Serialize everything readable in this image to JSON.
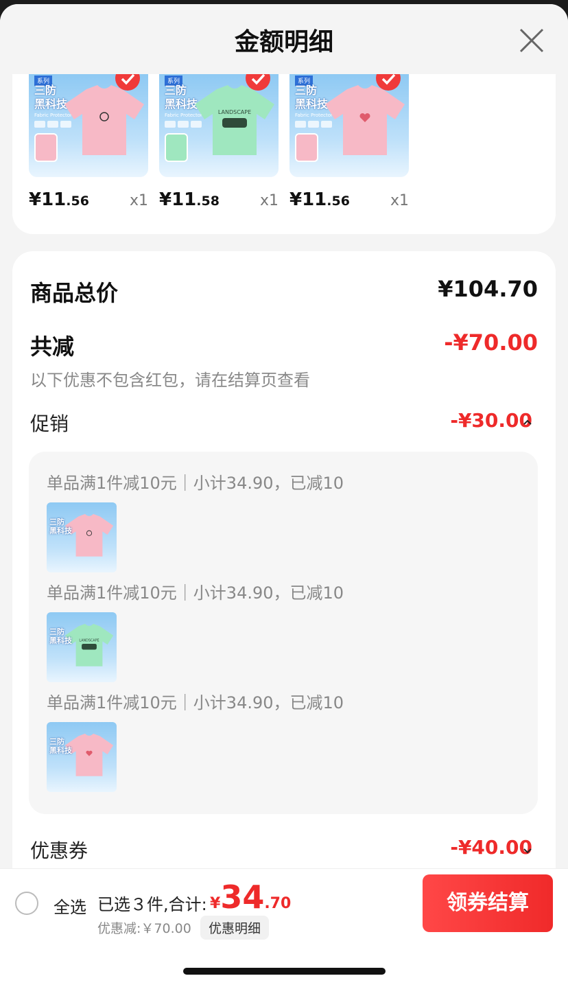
{
  "header": {
    "title": "金额明细"
  },
  "products": [
    {
      "tag": "系列",
      "title_line1": "三防",
      "title_line2": "黑科技",
      "sub": "Fabric Protector",
      "color": "pink",
      "logo": "flower",
      "price_int": "¥11",
      "price_dec": ".56",
      "qty": "x1"
    },
    {
      "tag": "系列",
      "title_line1": "三防",
      "title_line2": "黑科技",
      "sub": "Fabric Protector",
      "color": "green",
      "logo": "car",
      "price_int": "¥11",
      "price_dec": ".58",
      "qty": "x1"
    },
    {
      "tag": "系列",
      "title_line1": "三防",
      "title_line2": "黑科技",
      "sub": "Fabric Protector",
      "color": "pink",
      "logo": "heart",
      "price_int": "¥11",
      "price_dec": ".56",
      "qty": "x1"
    }
  ],
  "detail": {
    "total_label": "商品总价",
    "total_value": "¥104.70",
    "reduce_label": "共减",
    "reduce_value": "-¥70.00",
    "note": "以下优惠不包含红包，请在结算页查看",
    "promo_label": "促销",
    "promo_value": "-¥30.00",
    "promo_items": [
      {
        "text": "单品满1件减10元｜小计34.90，已减10",
        "color": "pink"
      },
      {
        "text": "单品满1件减10元｜小计34.90，已减10",
        "color": "green"
      },
      {
        "text": "单品满1件减10元｜小计34.90，已减10",
        "color": "pink"
      }
    ],
    "coupon_label": "优惠券",
    "coupon_value": "-¥40.00"
  },
  "bottom": {
    "select_all": "全选",
    "selected_text": "已选３件,合计:",
    "total_currency": "¥",
    "total_int": "34",
    "total_dec": ".70",
    "discount": "优惠减:￥70.00",
    "detail_link": "优惠明细",
    "checkout": "领券结算"
  },
  "colors": {
    "accent": "#ee2a2a",
    "pink_shirt": "#f7b9c6",
    "green_shirt": "#9fe7bf"
  }
}
